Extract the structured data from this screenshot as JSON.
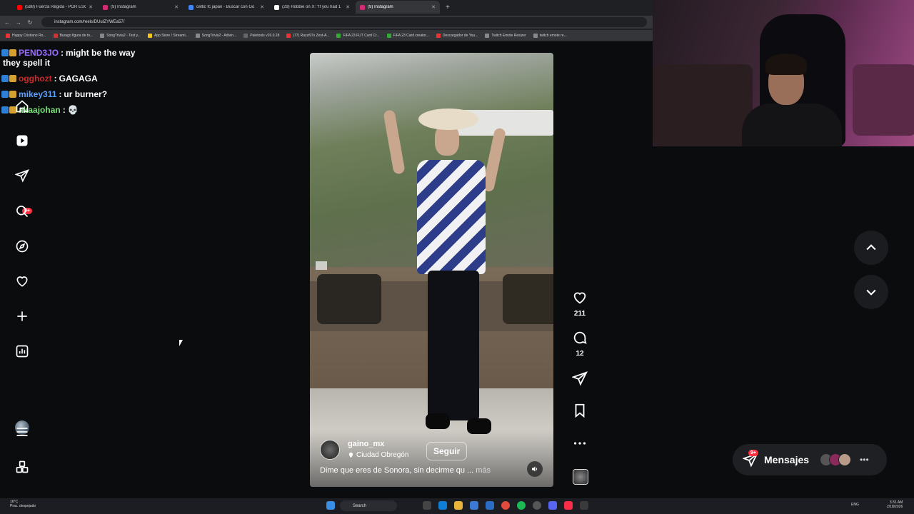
{
  "browser": {
    "tabs": [
      {
        "title": "(598) Fuerza Regida - POR ESC",
        "color": "#ff0000"
      },
      {
        "title": "(9) Instagram",
        "color": "#d62976"
      },
      {
        "title": "celtic fc japan - Buscar con Go",
        "color": "#4285f4"
      },
      {
        "title": "(29) Robbie on X: \"If you had 1",
        "color": "#ffffff"
      },
      {
        "title": "(9) Instagram",
        "color": "#d62976"
      }
    ],
    "url": "instagram.com/reels/DUuIZYWEa57/",
    "bookmarks": [
      "Happy Cristiano Ro...",
      "Burago figura de to...",
      "SongTrivia2 - Test y...",
      "App Store / Streami...",
      "SongTrivia2 - Adivin...",
      "Paletools v26.0.28",
      "(77) Razzi97s Zest-A...",
      "FIFA 23 FUT Card Cr...",
      "FIFA 23 Card creator...",
      "Descargador de You...",
      "Twitch Emote Resizer",
      "twitch emote re..."
    ]
  },
  "chat": [
    {
      "user": "PEND3JO",
      "color": "#9b6bff",
      "message": "might be the way",
      "cont": "they spell it"
    },
    {
      "user": "ogghozt",
      "color": "#cc2a2a",
      "message": "GAGAGA"
    },
    {
      "user": "mikey311",
      "color": "#5aa0ff",
      "message": "ur burner?"
    },
    {
      "user": "akaajohan",
      "color": "#7be07b",
      "message": "💀"
    }
  ],
  "sidebar": {
    "notification_badge": "9+"
  },
  "reel": {
    "username": "gaino_mx",
    "location": "Ciudad Obregón",
    "follow_label": "Seguir",
    "caption": "Dime que eres de Sonora, sin decirme qu ...",
    "more_label": "más",
    "likes": "211",
    "comments": "12"
  },
  "messages": {
    "label": "Mensajes",
    "badge": "9+"
  },
  "taskbar": {
    "temp": "16°C",
    "weather": "Prac. despejado",
    "search": "Search",
    "lang": "ENG",
    "time": "3:31 AM",
    "date": "2/18/2026"
  }
}
